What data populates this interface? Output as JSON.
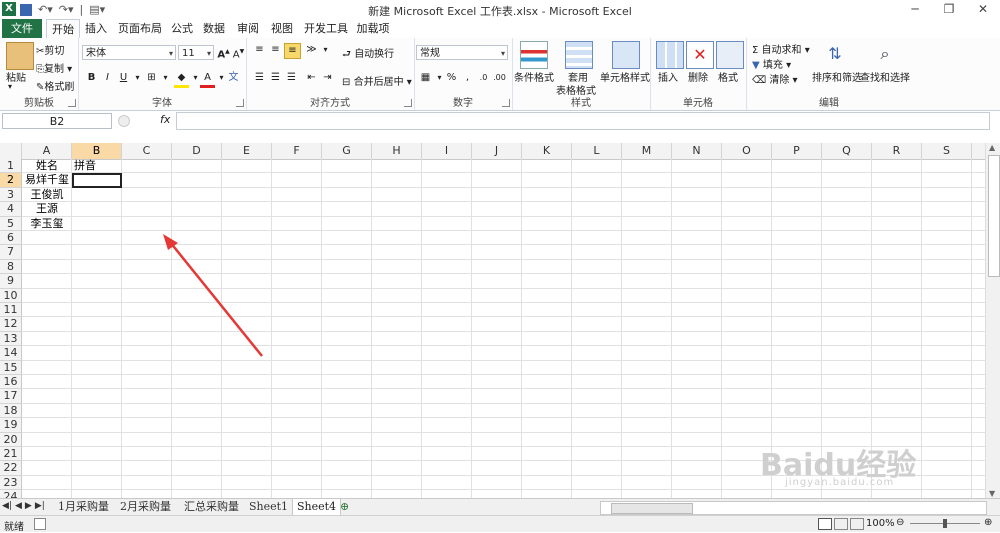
{
  "window": {
    "title": "新建 Microsoft Excel 工作表.xlsx - Microsoft Excel"
  },
  "tabs": [
    "文件",
    "开始",
    "插入",
    "页面布局",
    "公式",
    "数据",
    "审阅",
    "视图",
    "开发工具",
    "加载项"
  ],
  "active_tab": "开始",
  "ribbon": {
    "clipboard": {
      "paste": "粘贴",
      "cut": "剪切",
      "copy": "复制",
      "format_painter": "格式刷",
      "label": "剪贴板"
    },
    "font": {
      "name": "宋体",
      "size": "11",
      "bold": "B",
      "italic": "I",
      "underline": "U",
      "label": "字体"
    },
    "alignment": {
      "wrap": "自动换行",
      "merge": "合并后居中",
      "label": "对齐方式"
    },
    "number": {
      "format": "常规",
      "percent": "%",
      "comma": ",",
      "label": "数字"
    },
    "styles": {
      "conditional": "条件格式",
      "table_line1": "套用",
      "table_line2": "表格格式",
      "cell_styles": "单元格样式",
      "label": "样式"
    },
    "cells": {
      "insert": "插入",
      "delete": "删除",
      "format": "格式",
      "label": "单元格"
    },
    "editing": {
      "autosum": "自动求和",
      "fill": "填充",
      "clear": "清除",
      "sort": "排序和筛选",
      "find": "查找和选择",
      "label": "编辑"
    }
  },
  "formula_bar": {
    "name_box": "B2",
    "fx": "fx",
    "value": ""
  },
  "columns": [
    "A",
    "B",
    "C",
    "D",
    "E",
    "F",
    "G",
    "H",
    "I",
    "J",
    "K",
    "L",
    "M",
    "N",
    "O",
    "P",
    "Q",
    "R",
    "S"
  ],
  "rows": [
    "1",
    "2",
    "3",
    "4",
    "5",
    "6",
    "7",
    "8",
    "9",
    "10",
    "11",
    "12",
    "13",
    "14",
    "15",
    "16",
    "17",
    "18",
    "19",
    "20",
    "21",
    "22",
    "23",
    "24"
  ],
  "cells": {
    "A1": "姓名",
    "B1": "拼音",
    "A2": "易烊千玺",
    "A3": "王俊凯",
    "A4": "王源",
    "A5": "李玉玺"
  },
  "selected_cell": "B2",
  "sheet_tabs": [
    "1月采购量",
    "2月采购量",
    "汇总采购量",
    "Sheet1",
    "Sheet4"
  ],
  "active_sheet": "Sheet4",
  "status": {
    "ready": "就绪",
    "zoom": "100%"
  },
  "watermark": {
    "brand": "Baidu经验",
    "url": "jingyan.baidu.com"
  }
}
